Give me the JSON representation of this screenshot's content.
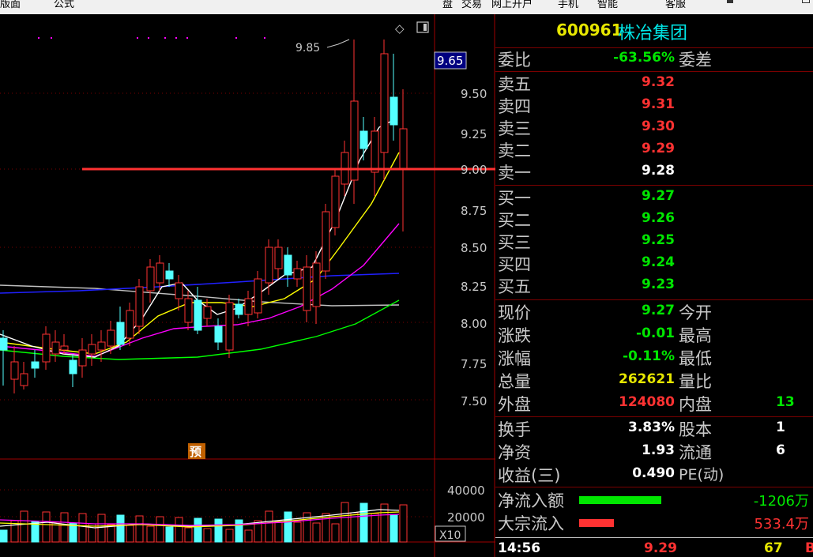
{
  "menubar": {
    "left_items": [
      "版面",
      "公式"
    ],
    "right_items": [
      "盘",
      "交易",
      "网上开户",
      "手机",
      "智能",
      "客服"
    ]
  },
  "chart": {
    "price_tick_labels": [
      "9.50",
      "9.25",
      "9.00",
      "8.75",
      "8.50",
      "8.25",
      "8.00",
      "7.75",
      "7.50"
    ],
    "current_price_tag": "9.65",
    "high_annotation": "9.85",
    "forecast_badge": "预",
    "volume_tick_labels": [
      "40000",
      "20000"
    ],
    "volume_unit": "X10",
    "colors": {
      "up": "#ff3232",
      "down": "#54ffff",
      "ma5": "#ffffff",
      "ma10": "#ffff00",
      "ma20": "#ff00ff",
      "ma60": "#00ff00",
      "ma_long1": "#2020ff",
      "ma_long2": "#c0c0c0",
      "ref_line": "#ff3232"
    }
  },
  "quote": {
    "code": "600961",
    "name": "株冶集团",
    "weibi": {
      "label": "委比",
      "value": "-63.56%",
      "label2": "委差"
    },
    "asks": [
      {
        "label": "卖五",
        "price": "9.32"
      },
      {
        "label": "卖四",
        "price": "9.31"
      },
      {
        "label": "卖三",
        "price": "9.30"
      },
      {
        "label": "卖二",
        "price": "9.29"
      },
      {
        "label": "卖一",
        "price": "9.28"
      }
    ],
    "bids": [
      {
        "label": "买一",
        "price": "9.27"
      },
      {
        "label": "买二",
        "price": "9.26"
      },
      {
        "label": "买三",
        "price": "9.25"
      },
      {
        "label": "买四",
        "price": "9.24"
      },
      {
        "label": "买五",
        "price": "9.23"
      }
    ],
    "stats": [
      {
        "label": "现价",
        "value": "9.27",
        "color": "green",
        "label2": "今开",
        "value2": ""
      },
      {
        "label": "涨跌",
        "value": "-0.01",
        "color": "green",
        "label2": "最高",
        "value2": ""
      },
      {
        "label": "涨幅",
        "value": "-0.11%",
        "color": "green",
        "label2": "最低",
        "value2": ""
      },
      {
        "label": "总量",
        "value": "262621",
        "color": "yellow",
        "label2": "量比",
        "value2": ""
      },
      {
        "label": "外盘",
        "value": "124080",
        "color": "red",
        "label2": "内盘",
        "value2": "13"
      }
    ],
    "stats2": [
      {
        "label": "换手",
        "value": "3.83%",
        "label2": "股本",
        "value2": "1"
      },
      {
        "label": "净资",
        "value": "1.93",
        "label2": "流通",
        "value2": "6"
      },
      {
        "label": "收益(三)",
        "value": "0.490",
        "label2": "PE(动)",
        "value2": ""
      }
    ],
    "flows": [
      {
        "label": "净流入额",
        "value": "-1206万",
        "color": "#00e600",
        "bar_fraction": 1.0
      },
      {
        "label": "大宗流入",
        "value": "533.4万",
        "color": "#ff3232",
        "bar_fraction": 0.42
      }
    ],
    "tick": {
      "time": "14:56",
      "price": "9.29",
      "volume": "67",
      "flag": "B"
    }
  }
}
